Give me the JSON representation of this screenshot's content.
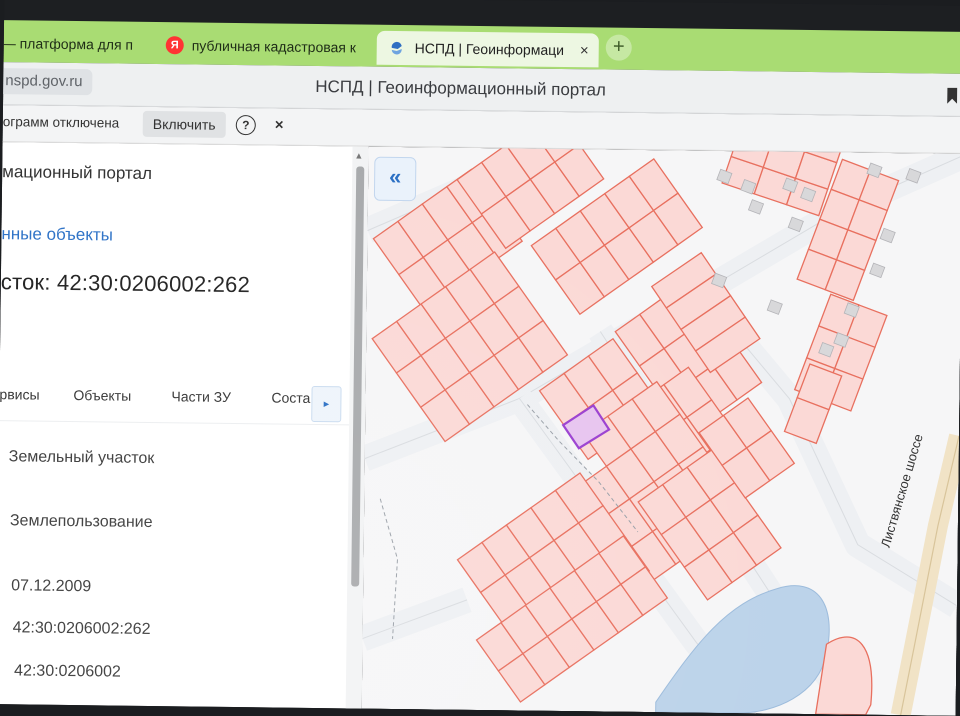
{
  "browser": {
    "tabs": [
      {
        "title": "— платформа для п",
        "icon": "generic-page-icon",
        "active": false
      },
      {
        "title": "публичная кадастровая к",
        "icon": "yandex-icon",
        "active": false
      },
      {
        "title": "НСПД | Геоинформаци",
        "icon": "nspd-icon",
        "active": true
      }
    ],
    "close_symbol": "×",
    "new_tab_symbol": "+",
    "yandex_letter": "Я",
    "domain": "nspd.gov.ru",
    "page_title": "НСПД | Геоинформационный портал"
  },
  "infobar": {
    "text": "ограмм отключена",
    "enable_label": "Включить",
    "help_symbol": "?",
    "close_symbol": "×"
  },
  "panel": {
    "portal_name": "мационный портал",
    "objects_link": "нные объекты",
    "parcel_heading": "сток: 42:30:0206002:262",
    "tabs": [
      "рвисы",
      "Объекты",
      "Части ЗУ",
      "Соста"
    ],
    "tabs_next_symbol": "▸",
    "properties": [
      "Земельный участок",
      "Землепользование",
      "07.12.2009",
      "42:30:0206002:262",
      "42:30:0206002"
    ]
  },
  "map": {
    "collapse_symbol": "«",
    "road_label": "Листвянское шоссе",
    "colors": {
      "parcel_fill": "#fbd9d6",
      "parcel_stroke": "#e8705f",
      "selected_fill": "#e7c4ef",
      "selected_stroke": "#9a3fd0",
      "water": "#bcd3ea",
      "road": "#eef0f3"
    }
  }
}
